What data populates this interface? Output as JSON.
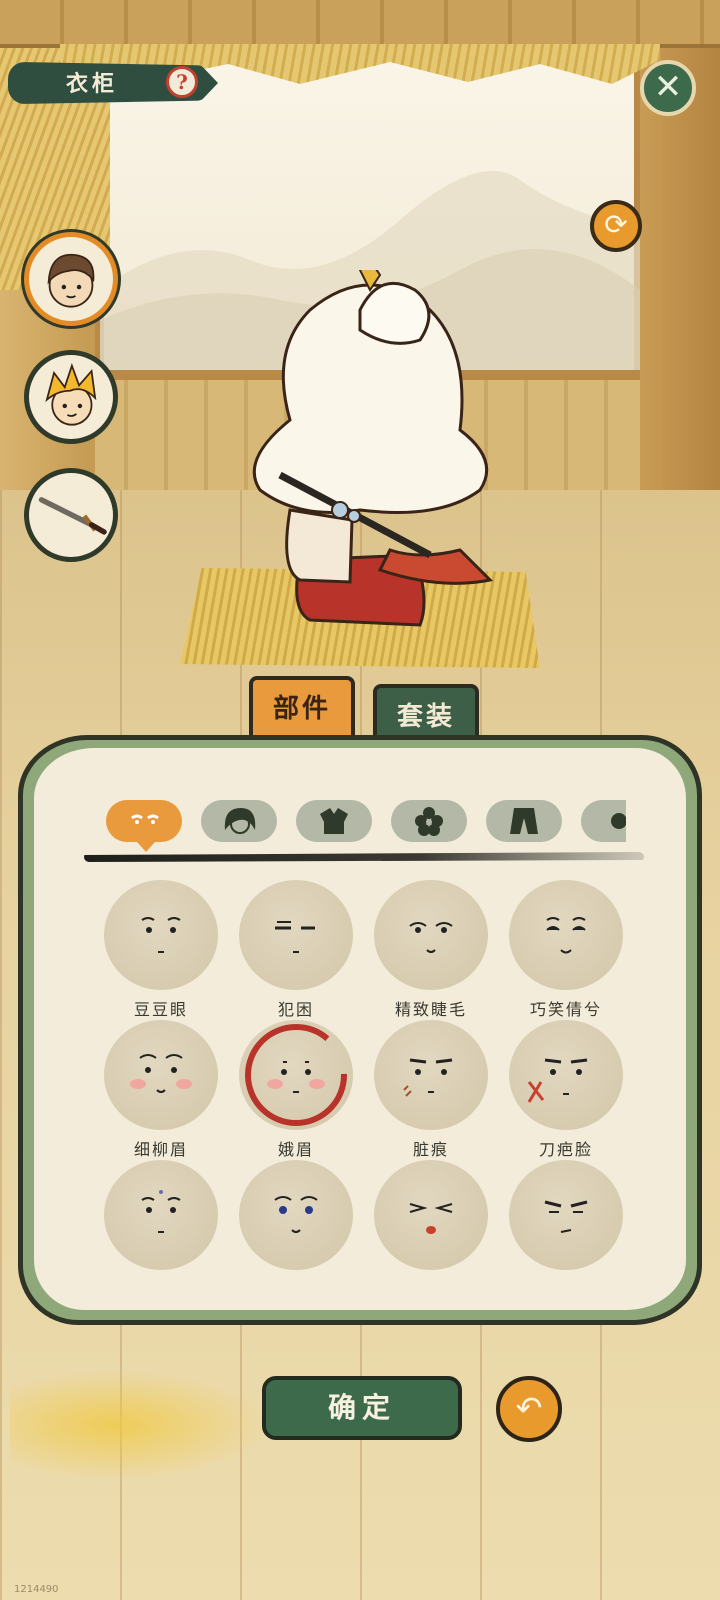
{
  "header": {
    "title": "衣柜",
    "help_symbol": "?",
    "close_symbol": "✕",
    "rotate_symbol": "⟳"
  },
  "side_characters": [
    {
      "name": "brown-hair-boy",
      "active": true
    },
    {
      "name": "golden-hair-boy",
      "active": false
    },
    {
      "name": "sword",
      "active": false
    }
  ],
  "tabs": {
    "parts": "部件",
    "sets": "套装",
    "active": "parts"
  },
  "categories": [
    {
      "icon": "face-icon",
      "active": true
    },
    {
      "icon": "hair-icon",
      "active": false
    },
    {
      "icon": "clothes-icon",
      "active": false
    },
    {
      "icon": "flower-icon",
      "active": false
    },
    {
      "icon": "pants-icon",
      "active": false
    },
    {
      "icon": "more-icon",
      "active": false
    }
  ],
  "faces": [
    {
      "label": "豆豆眼"
    },
    {
      "label": "犯困"
    },
    {
      "label": "精致睫毛"
    },
    {
      "label": "巧笑倩兮"
    },
    {
      "label": "细柳眉"
    },
    {
      "label": "娥眉"
    },
    {
      "label": "脏痕"
    },
    {
      "label": "刀疤脸"
    },
    {
      "label": ""
    },
    {
      "label": ""
    },
    {
      "label": ""
    },
    {
      "label": ""
    }
  ],
  "selected_face": "娥眉",
  "buttons": {
    "confirm": "确定",
    "undo_symbol": "↶"
  },
  "build_id": "1214490",
  "colors": {
    "accent_orange": "#e89a3c",
    "accent_green": "#3e6a4c",
    "selection_red": "#b8342a"
  }
}
